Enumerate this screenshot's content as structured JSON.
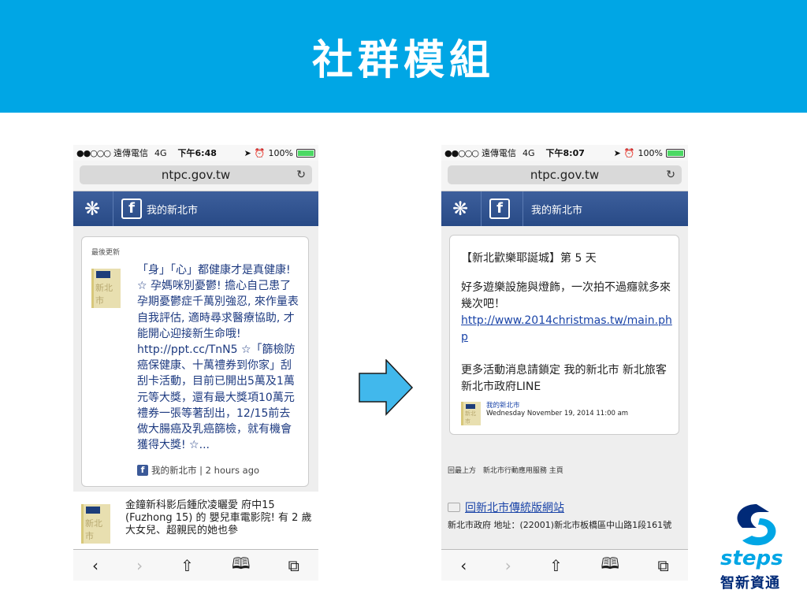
{
  "header": {
    "title": "社群模組"
  },
  "left_phone": {
    "status": {
      "signal": "●●○○○",
      "carrier": "遠傳電信",
      "network": "4G",
      "time": "下午6:48",
      "battery": "100%"
    },
    "url": "ntpc.gov.tw",
    "appbar_title": "我的新北市",
    "card": {
      "label": "最後更新",
      "body": "「身」「心」都健康才是真健康! ☆ 孕媽咪別憂鬱! 擔心自己患了孕期憂鬱症千萬別強忍, 來作量表自我評估, 適時尋求醫療協助, 才能開心迎接新生命哦! http://ppt.cc/TnN5 ☆「篩檢防癌保健康、十萬禮券到你家」刮刮卡活動，目前已開出5萬及1萬元等大獎，還有最大獎項10萬元禮券一張等著刮出，12/15前去做大腸癌及乳癌篩檢，就有機會獲得大獎! ☆...",
      "meta": "我的新北市 | 2 hours ago"
    },
    "list_item": "金鐘新科影后鍾欣凌曬愛 府中15 (Fuzhong 15) 的 嬰兒車電影院! 有 2 歲大女兒、超親民的她也參",
    "toolbar": [
      "‹",
      "›",
      "⇧",
      "🕮",
      "⧉"
    ]
  },
  "right_phone": {
    "status": {
      "signal": "●●○○○",
      "carrier": "遠傳電信",
      "network": "4G",
      "time": "下午8:07",
      "battery": "100%"
    },
    "url": "ntpc.gov.tw",
    "appbar_title": "我的新北市",
    "card": {
      "title": "【新北歡樂耶誕城】第 5 天",
      "para1": "好多遊樂設施與燈飾，一次拍不過癮就多來幾次吧！",
      "link": "http://www.2014christmas.tw/main.php",
      "para2": "更多活動消息請鎖定 我的新北市 新北旅客 新北市政府LINE",
      "source_name": "我的新北市",
      "source_date": "Wednesday November 19, 2014 11:00 am"
    },
    "footer_links": [
      "回最上方",
      "新北市行動應用服務 主頁"
    ],
    "back_link": "回新北市傳統版網站",
    "address": "新北市政府 地址：(22001)新北市板橋區中山路1段161號",
    "toolbar": [
      "‹",
      "›",
      "⇧",
      "🕮",
      "⧉"
    ]
  },
  "logo": {
    "word": "steps",
    "chinese": "智新資通"
  },
  "colors": {
    "header": "#00a6e5",
    "appbar": "#2c4d8a",
    "arrow": "#41b8ec",
    "link": "#1a44a8"
  }
}
